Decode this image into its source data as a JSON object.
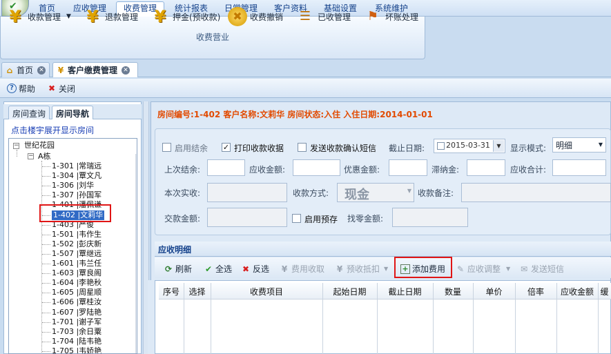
{
  "menu": {
    "items": [
      "首页",
      "应收管理",
      "收费管理",
      "统计报表",
      "日常管理",
      "客户资料",
      "基础设置",
      "系统维护"
    ],
    "active": "收费管理"
  },
  "ribbon": {
    "buttons": [
      {
        "label": "收款管理",
        "icon": "yen-coin-icon"
      },
      {
        "label": "退款管理",
        "icon": "yen-coin-icon"
      },
      {
        "label": "押金(预收款)",
        "icon": "yen-coin-icon"
      },
      {
        "label": "收费撤销",
        "icon": "cancel-coin-icon"
      },
      {
        "label": "已收管理",
        "icon": "document-list-icon"
      },
      {
        "label": "坏账处理",
        "icon": "bad-debt-icon"
      }
    ],
    "group_label": "收费营业"
  },
  "tabs": [
    {
      "label": "首页"
    },
    {
      "label": "客户缴费管理"
    }
  ],
  "toolbar": {
    "help": "帮助",
    "close": "关闭"
  },
  "left": {
    "tabs": [
      "房间查询",
      "房间导航"
    ],
    "hint": "点击楼宇展开显示房间",
    "tree": {
      "root": "世纪花园",
      "building": "A栋",
      "rooms": [
        "1-301 |常瑞远",
        "1-304 |覃文凡",
        "1-306 |刘华",
        "1-307 |孙国军",
        "1-401 |潘佩谦",
        "1-402 |文莉华",
        "1-403 |严俊",
        "1-501 |韦作生",
        "1-502 |彭庆新",
        "1-507 |覃继远",
        "1-601 |韦兰任",
        "1-603 |覃良阁",
        "1-604 |李艳秋",
        "1-605 |周星顺",
        "1-606 |覃桂汝",
        "1-607 |罗陆艳",
        "1-701 |谢子军",
        "1-703 |余日粟",
        "1-704 |陆韦艳",
        "1-705 |韦娇艳"
      ],
      "selected_index": 5
    }
  },
  "info": {
    "text": "房间编号:1-402 客户名称:文莉华 房间状态:入住 入住日期:2014-01-01"
  },
  "form": {
    "cb_enable_settle": "启用结余",
    "cb_print_receipt": "打印收款收据",
    "cb_send_sms": "发送收款确认短信",
    "deadline_label": "截止日期:",
    "deadline_value": "2015-03-31",
    "display_mode_label": "显示模式:",
    "display_mode_value": "明细",
    "last_balance": "上次结余:",
    "receivable": "应收金额:",
    "discount": "优惠金额:",
    "late_fee": "滞纳金:",
    "receivable_total": "应收合计:",
    "actual_received": "本次实收:",
    "pay_method_label": "收款方式:",
    "pay_method_value": "现金",
    "remark": "收款备注:",
    "paid_amount": "交款金额:",
    "cb_enable_prepay": "启用预存",
    "change_amount": "找零金额:"
  },
  "list": {
    "title": "应收明细",
    "toolbar": [
      "刷新",
      "全选",
      "反选",
      "费用收取",
      "预收抵扣",
      "添加费用",
      "应收调整",
      "发送短信"
    ],
    "columns": [
      "序号",
      "选择",
      "收费项目",
      "起始日期",
      "截止日期",
      "数量",
      "单价",
      "倍率",
      "应收金额",
      "缓"
    ]
  }
}
